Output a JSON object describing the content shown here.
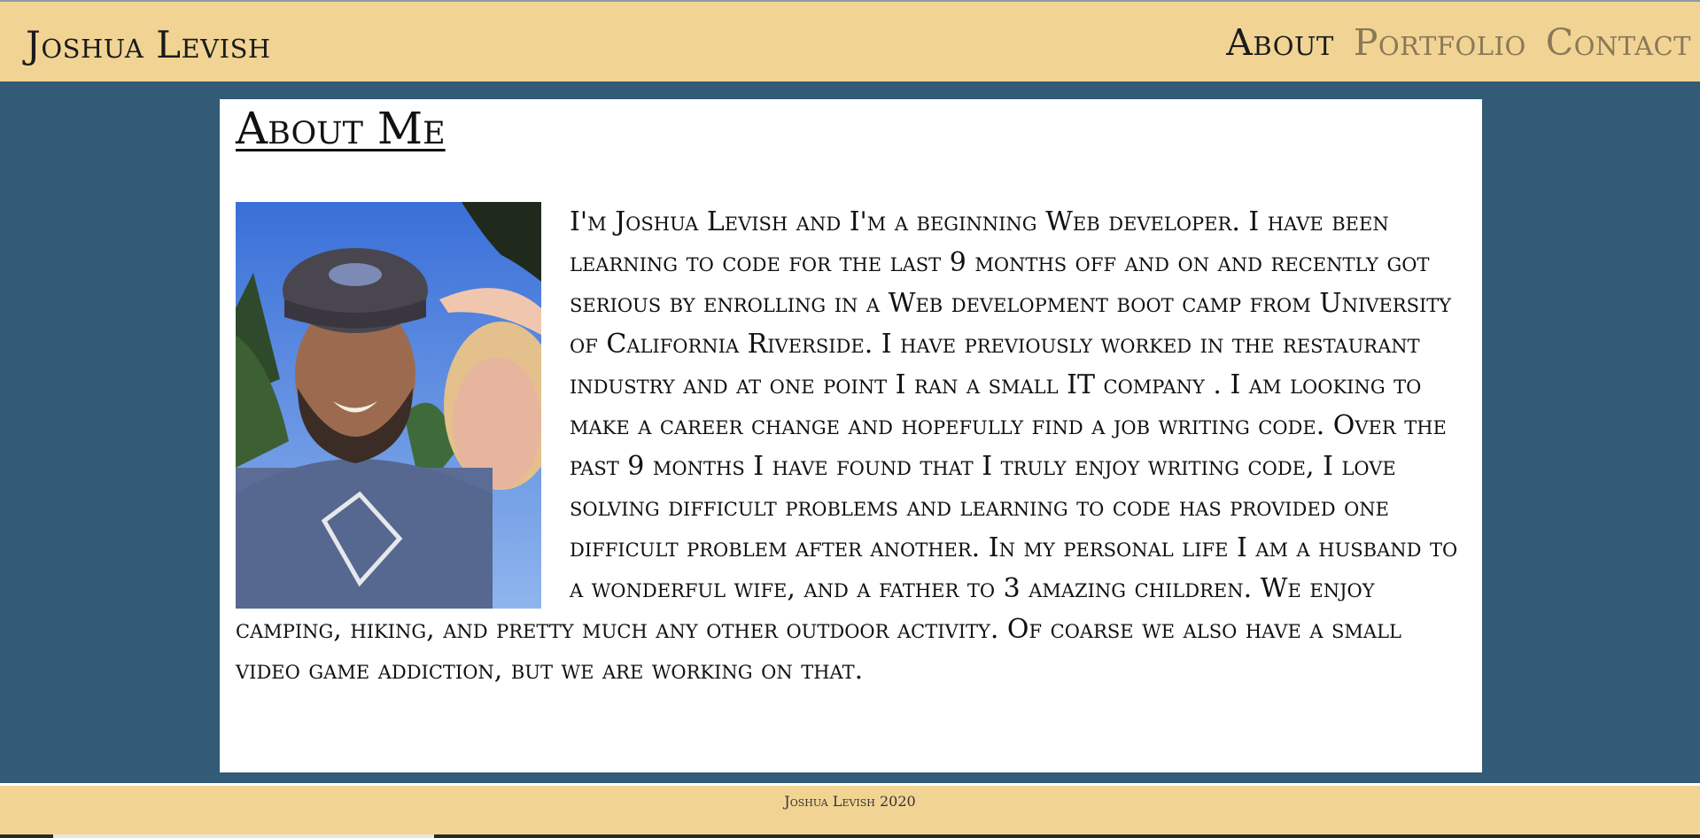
{
  "header": {
    "brand": "Joshua Levish",
    "nav": [
      {
        "label": "About",
        "active": true
      },
      {
        "label": "Portfolio",
        "active": false
      },
      {
        "label": "Contact",
        "active": false
      }
    ]
  },
  "main": {
    "title": "About Me",
    "bio": "I'm Joshua Levish and I'm a beginning Web developer. I have been learning to code for the last 9 months off and on and recently got serious by enrolling in a Web development boot camp from University of California Riverside. I have previously worked in the restaurant industry and at one point I ran a small IT company . I am looking to make a career change and hopefully find a job writing code. Over the past 9 months I have found that I truly enjoy writing code, I love solving difficult problems and learning to code has provided one difficult problem after another. In my personal life I am a husband to a wonderful wife, and a father to 3 amazing children. We enjoy camping, hiking, and pretty much any other outdoor activity. Of coarse we also have a small video game addiction, but we are working on that."
  },
  "footer": {
    "copyright": "Joshua Levish 2020"
  },
  "colors": {
    "header_bg": "#f1d494",
    "page_bg": "#335a76",
    "nav_inactive": "#8a7958"
  }
}
